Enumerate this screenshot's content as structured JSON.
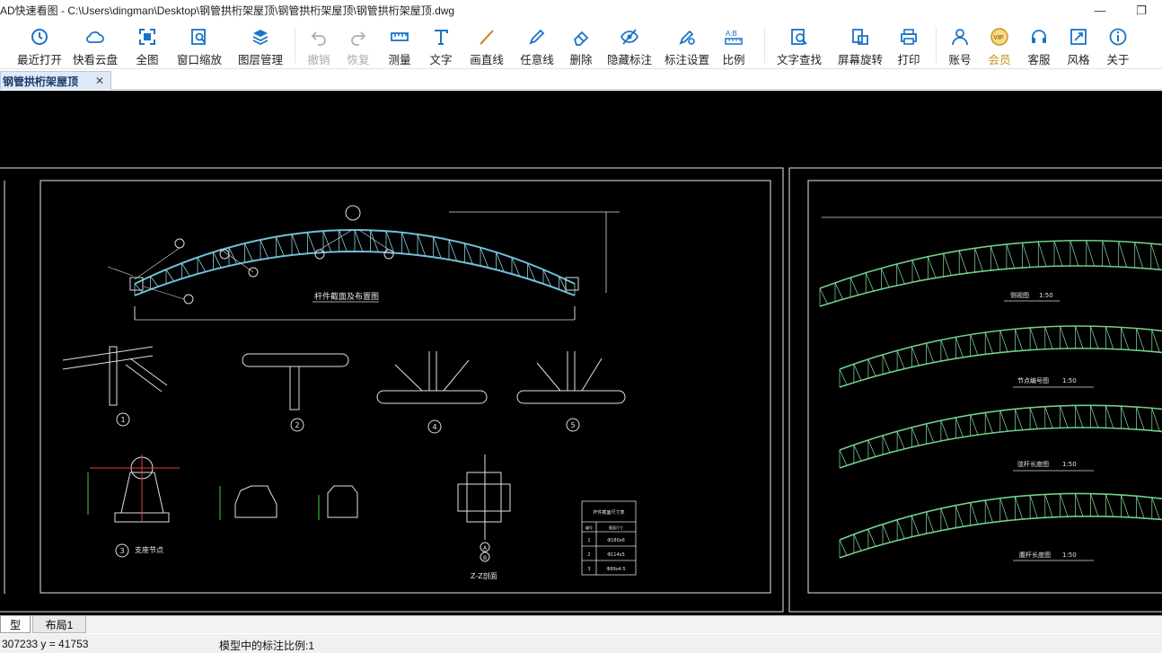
{
  "window": {
    "title": "AD快速看图 - C:\\Users\\dingman\\Desktop\\钢管拱桁架屋顶\\钢管拱桁架屋顶\\钢管拱桁架屋顶.dwg"
  },
  "window_controls": {
    "minimize": "—",
    "restore": "❐"
  },
  "toolbar": {
    "recent_open": "最近打开",
    "cloud": "快看云盘",
    "full_view": "全图",
    "window_zoom": "窗口缩放",
    "layer_mgmt": "图层管理",
    "undo": "撤销",
    "redo": "恢复",
    "measure": "测量",
    "text": "文字",
    "draw_line": "画直线",
    "freehand": "任意线",
    "delete": "删除",
    "hide_annot": "隐藏标注",
    "annot_settings": "标注设置",
    "ratio": "比例",
    "text_search": "文字查找",
    "screen_rotate": "屏幕旋转",
    "print": "打印",
    "account": "账号",
    "vip": "会员",
    "support": "客服",
    "style": "风格",
    "about": "关于"
  },
  "document_tab": {
    "label": "钢管拱桁架屋顶",
    "close": "✕"
  },
  "drawing": {
    "plan_title": "杆件截面及布置图",
    "side_view": "侧视图",
    "side_view_scale": "1:50",
    "node_numbering": "节点编号图",
    "node_numbering_scale": "1:50",
    "top_chord_length": "弦杆长度图",
    "top_chord_length_scale": "1:50",
    "web_length": "腹杆长度图",
    "web_length_scale": "1:50",
    "support_detail": "支座节点",
    "section_zz": "Z-Z剖面",
    "table_title": "杆件截面尺寸表",
    "table_header": [
      "编号",
      "截面尺寸"
    ],
    "table_rows": [
      [
        "1",
        "Φ180x6"
      ],
      [
        "2",
        "Φ114x5"
      ],
      [
        "3",
        "Φ89x4.5"
      ]
    ],
    "detail_labels": [
      "1",
      "2",
      "4",
      "5",
      "3",
      "A",
      "B"
    ]
  },
  "layout_tabs": {
    "model": "型",
    "layout1": "布局1"
  },
  "status": {
    "coords": "307233  y = 41753",
    "scale_text": "模型中的标注比例:1"
  }
}
